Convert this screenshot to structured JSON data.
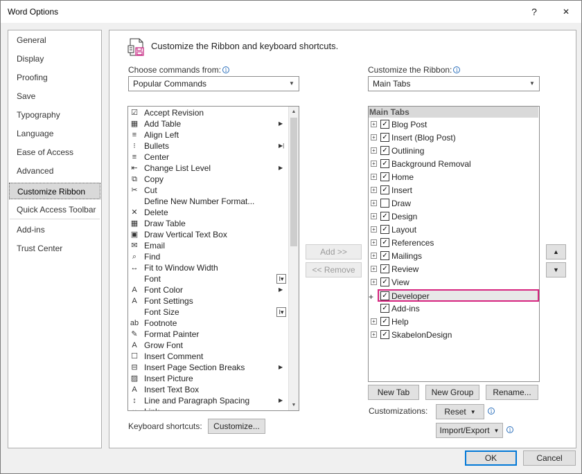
{
  "window": {
    "title": "Word Options",
    "help": "?",
    "close": "✕"
  },
  "nav": {
    "items": [
      {
        "label": "General",
        "name": "nav-general"
      },
      {
        "label": "Display",
        "name": "nav-display"
      },
      {
        "label": "Proofing",
        "name": "nav-proofing"
      },
      {
        "label": "Save",
        "name": "nav-save"
      },
      {
        "label": "Typography",
        "name": "nav-typography"
      },
      {
        "label": "Language",
        "name": "nav-language"
      },
      {
        "label": "Ease of Access",
        "name": "nav-ease-of-access"
      },
      {
        "label": "Advanced",
        "name": "nav-advanced"
      },
      {
        "label": "Customize Ribbon",
        "name": "nav-customize-ribbon"
      },
      {
        "label": "Quick Access Toolbar",
        "name": "nav-quick-access-toolbar"
      },
      {
        "label": "Add-ins",
        "name": "nav-add-ins"
      },
      {
        "label": "Trust Center",
        "name": "nav-trust-center"
      }
    ],
    "selected": "Customize Ribbon"
  },
  "main": {
    "header": "Customize the Ribbon and keyboard shortcuts.",
    "choose_label": "Choose commands from:",
    "choose_value": "Popular Commands",
    "customize_label": "Customize the Ribbon:",
    "customize_value": "Main Tabs",
    "info_glyph": "i",
    "dropdown_arrow": "▼"
  },
  "commands": [
    {
      "label": "Accept Revision",
      "icon": "☑",
      "sub": ""
    },
    {
      "label": "Add Table",
      "icon": "▦",
      "sub": "▶"
    },
    {
      "label": "Align Left",
      "icon": "≡",
      "sub": ""
    },
    {
      "label": "Bullets",
      "icon": "⁝",
      "sub": "▶|"
    },
    {
      "label": "Center",
      "icon": "≡",
      "sub": ""
    },
    {
      "label": "Change List Level",
      "icon": "⇤",
      "sub": "▶"
    },
    {
      "label": "Copy",
      "icon": "⧉",
      "sub": ""
    },
    {
      "label": "Cut",
      "icon": "✂",
      "sub": ""
    },
    {
      "label": "Define New Number Format...",
      "icon": "",
      "sub": ""
    },
    {
      "label": "Delete",
      "icon": "✕",
      "sub": ""
    },
    {
      "label": "Draw Table",
      "icon": "▦",
      "sub": ""
    },
    {
      "label": "Draw Vertical Text Box",
      "icon": "▣",
      "sub": ""
    },
    {
      "label": "Email",
      "icon": "✉",
      "sub": ""
    },
    {
      "label": "Find",
      "icon": "⌕",
      "sub": ""
    },
    {
      "label": "Fit to Window Width",
      "icon": "↔",
      "sub": ""
    },
    {
      "label": "Font",
      "icon": "",
      "sub": "I▾"
    },
    {
      "label": "Font Color",
      "icon": "A",
      "sub": "▶"
    },
    {
      "label": "Font Settings",
      "icon": "A",
      "sub": ""
    },
    {
      "label": "Font Size",
      "icon": "",
      "sub": "I▾"
    },
    {
      "label": "Footnote",
      "icon": "ab",
      "sub": ""
    },
    {
      "label": "Format Painter",
      "icon": "✎",
      "sub": ""
    },
    {
      "label": "Grow Font",
      "icon": "A",
      "sub": ""
    },
    {
      "label": "Insert Comment",
      "icon": "☐",
      "sub": ""
    },
    {
      "label": "Insert Page  Section Breaks",
      "icon": "⊟",
      "sub": "▶"
    },
    {
      "label": "Insert Picture",
      "icon": "▨",
      "sub": ""
    },
    {
      "label": "Insert Text Box",
      "icon": "A",
      "sub": ""
    },
    {
      "label": "Line and Paragraph Spacing",
      "icon": "↕",
      "sub": "▶"
    },
    {
      "label": "Link",
      "icon": "∞",
      "sub": ""
    }
  ],
  "scroll": {
    "up": "▲",
    "down": "▼"
  },
  "tree": {
    "header": "Main Tabs",
    "expand_glyph": "⊞",
    "check_glyph": "✓",
    "items": [
      {
        "label": "Blog Post",
        "checked": true,
        "expand": true
      },
      {
        "label": "Insert (Blog Post)",
        "checked": true,
        "expand": true
      },
      {
        "label": "Outlining",
        "checked": true,
        "expand": true
      },
      {
        "label": "Background Removal",
        "checked": true,
        "expand": true
      },
      {
        "label": "Home",
        "checked": true,
        "expand": true
      },
      {
        "label": "Insert",
        "checked": true,
        "expand": true
      },
      {
        "label": "Draw",
        "checked": false,
        "expand": true
      },
      {
        "label": "Design",
        "checked": true,
        "expand": true
      },
      {
        "label": "Layout",
        "checked": true,
        "expand": true
      },
      {
        "label": "References",
        "checked": true,
        "expand": true
      },
      {
        "label": "Mailings",
        "checked": true,
        "expand": true
      },
      {
        "label": "Review",
        "checked": true,
        "expand": true
      },
      {
        "label": "View",
        "checked": true,
        "expand": true
      },
      {
        "label": "Developer",
        "checked": true,
        "expand": true,
        "highlight": true
      },
      {
        "label": "Add-ins",
        "checked": true,
        "expand": false
      },
      {
        "label": "Help",
        "checked": true,
        "expand": true
      },
      {
        "label": "SkabelonDesign",
        "checked": true,
        "expand": true
      }
    ]
  },
  "buttons": {
    "add": "Add >>",
    "remove": "<< Remove",
    "move_up": "▲",
    "move_down": "▼",
    "new_tab": "New Tab",
    "new_group": "New Group",
    "rename": "Rename...",
    "customizations_label": "Customizations:",
    "reset": "Reset",
    "import_export": "Import/Export",
    "keyboard_label": "Keyboard shortcuts:",
    "customize": "Customize...",
    "ok": "OK",
    "cancel": "Cancel"
  },
  "colors": {
    "highlight_border": "#d6247f",
    "accent": "#0078d7"
  }
}
